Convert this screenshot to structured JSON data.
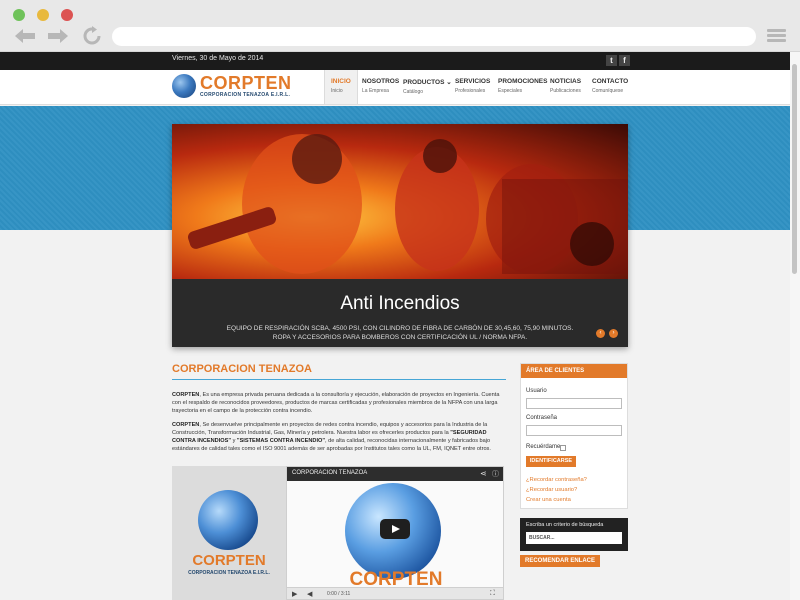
{
  "header": {
    "date": "Viernes, 30 de Mayo de 2014",
    "social": [
      "t",
      "f"
    ],
    "logo_text": "CORPTEN",
    "logo_sub": "CORPORACION TENAZOA E.I.R.L."
  },
  "nav": [
    {
      "label": "INICIO",
      "sub": "Inicio",
      "active": true
    },
    {
      "label": "NOSOTROS",
      "sub": "La Empresa"
    },
    {
      "label": "PRODUCTOS",
      "sub": "Catálogo",
      "has_dropdown": true
    },
    {
      "label": "SERVICIOS",
      "sub": "Profesionales"
    },
    {
      "label": "PROMOCIONES",
      "sub": "Especiales"
    },
    {
      "label": "NOTICIAS",
      "sub": "Publicaciones"
    },
    {
      "label": "CONTACTO",
      "sub": "Comuníquese"
    }
  ],
  "slider": {
    "title": "Anti Incendios",
    "desc_line1": "EQUIPO DE RESPIRACIÓN SCBA, 4500 PSI, CON CILINDRO DE FIBRA DE CARBÓN DE 30,45,60, 75,90 MINUTOS.",
    "desc_line2": "ROPA Y ACCESORIOS PARA BOMBEROS CON CERTIFICACIÓN UL / NORMA NFPA."
  },
  "main": {
    "title": "CORPORACION TENAZOA",
    "p1_brand": "CORPTEN",
    "p1_text": ", Es una empresa privada peruana dedicada a la consultoría y ejecución, elaboración de proyectos en Ingeniería. Cuenta con el respaldo de reconocidos proveedores, productos de marcas certificadas y profesionales miembros de la NFPA con una larga trayectoria en el campo de la protección contra incendio.",
    "p2_brand": "CORPTEN",
    "p2_a": ", Se desenvuelve principalmente en proyectos de redes contra incendio, equipos y accesorios para la Industria de la Construcción, Transformación Industrial, Gas, Minería y petrolera. Nuestra labor es ofrecerles productos para la ",
    "p2_b": "\"SEGURIDAD CONTRA INCENDIOS\"",
    "p2_c": " y ",
    "p2_d": "\"SISTEMAS CONTRA INCENDIO\"",
    "p2_e": ", de alta calidad, reconocidas internacionalmente y fabricados bajo estándares de calidad tales como el ISO 9001 además de ser aprobadas por Institutos tales como la UL, FM, IQNET entre otros.",
    "media_brand": "CORPTEN",
    "media_sub": "CORPORACION TENAZOA E.I.R.L.",
    "video_title": "CORPORACION TENAZOA",
    "video_brand": "CORPTEN",
    "video_time": "0:00 / 3:11"
  },
  "client_area": {
    "title": "ÁREA DE CLIENTES",
    "user_label": "Usuario",
    "pass_label": "Contraseña",
    "remember_label": "Recuérdame",
    "login_button": "IDENTIFICARSE",
    "links": [
      "¿Recordar contraseña?",
      "¿Recordar usuario?",
      "Crear una cuenta"
    ]
  },
  "search": {
    "label": "Escriba un criterio de búsqueda",
    "placeholder": "BUSCAR..."
  },
  "recommend_button": "RECOMENDAR ENLACE",
  "colors": {
    "accent": "#e27a2a",
    "band": "#2f91c3",
    "topbar": "#1b1b1b"
  }
}
